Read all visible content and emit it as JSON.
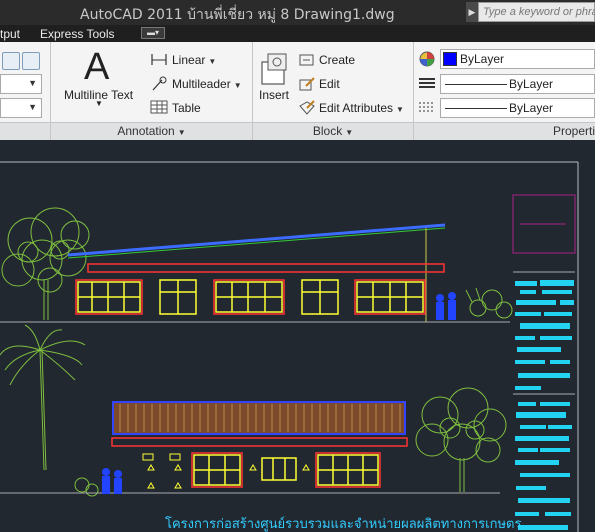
{
  "titlebar": {
    "title": "AutoCAD 2011     บ้านพี่เชี่ยว หมู่ 8 Drawing1.dwg",
    "search_placeholder": "Type a keyword or phrase"
  },
  "tabs": [
    {
      "label": "tput"
    },
    {
      "label": "Express Tools"
    }
  ],
  "ribbon": {
    "annotation": {
      "multiline_text": "Multiline Text",
      "linear": "Linear",
      "multileader": "Multileader",
      "table": "Table",
      "panel_label": "Annotation"
    },
    "block": {
      "insert": "Insert",
      "create": "Create",
      "edit": "Edit",
      "edit_attributes": "Edit Attributes",
      "panel_label": "Block"
    },
    "properties": {
      "color": "ByLayer",
      "linetype": "ByLayer",
      "lineweight": "ByLayer",
      "panel_label": "Properti",
      "color_swatch": "#0000ff"
    }
  },
  "drawing": {
    "caption": "โครงการก่อสร้างศูนย์รวบรวมและจำหน่ายผลผลิตทางการเกษตร",
    "background": "#212830"
  }
}
